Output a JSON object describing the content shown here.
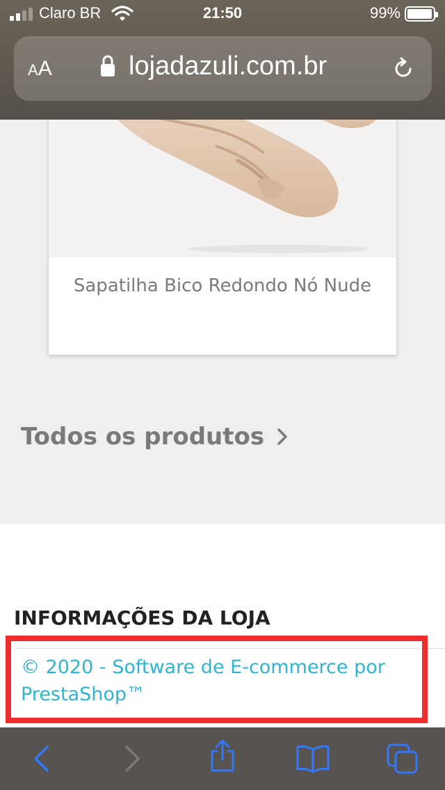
{
  "status_bar": {
    "carrier": "Claro BR",
    "time": "21:50",
    "battery_pct": "99%",
    "signal_bars": 2,
    "battery_level": 0.99
  },
  "browser": {
    "text_size_small": "A",
    "text_size_big": "A",
    "url": "lojadazuli.com.br",
    "icons": [
      "lock-icon",
      "reload-icon",
      "back-icon",
      "forward-icon",
      "share-icon",
      "bookmarks-icon",
      "tabs-icon"
    ]
  },
  "product": {
    "name": "Sapatilha Bico Redondo Nó Nude"
  },
  "all_products_link": "Todos os produtos",
  "footer": {
    "info_title": "INFORMAÇÕES DA LOJA",
    "copyright": "© 2020 - Software de E-commerce por PrestaShop™"
  },
  "colors": {
    "link": "#2fb5d2",
    "highlight": "#ee2d2d",
    "ios_blue": "#3478f6"
  }
}
